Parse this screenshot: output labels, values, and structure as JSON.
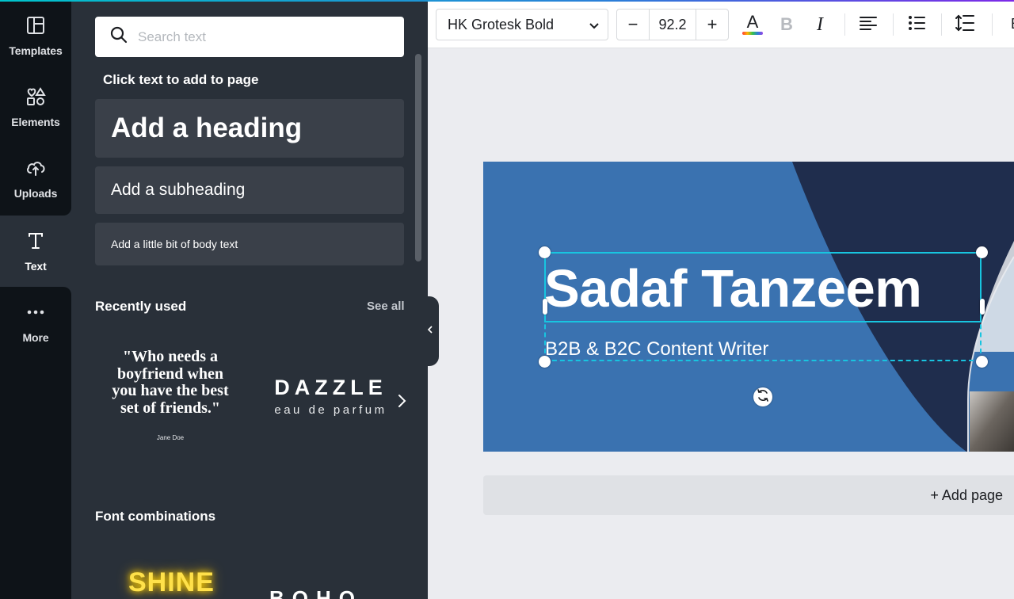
{
  "colors": {
    "rail_bg": "#0e1318",
    "panel_bg": "#293039",
    "button_bg": "#3a4049",
    "design_blue": "#3a72b0",
    "design_navy": "#1f2d4d",
    "selection": "#18c5e0",
    "canvas_bg": "#ebecf0"
  },
  "rail": {
    "items": [
      {
        "label": "Templates",
        "icon": "templates-icon"
      },
      {
        "label": "Elements",
        "icon": "elements-icon"
      },
      {
        "label": "Uploads",
        "icon": "uploads-icon"
      },
      {
        "label": "Text",
        "icon": "text-icon",
        "active": true
      },
      {
        "label": "More",
        "icon": "more-icon"
      }
    ]
  },
  "panel": {
    "search_placeholder": "Search text",
    "hint": "Click text to add to page",
    "heading_button": "Add a heading",
    "subheading_button": "Add a subheading",
    "body_button": "Add a little bit of body text",
    "recently_used_title": "Recently used",
    "see_all": "See all",
    "quote_template": {
      "text": "\"Who needs a boyfriend when you have the best set of friends.\"",
      "author": "Jane Doe"
    },
    "dazzle_template": {
      "title": "DAZZLE",
      "subtitle": "eau de parfum"
    },
    "font_combinations_title": "Font combinations",
    "combo_1": "SHINE",
    "combo_2": "BOHO"
  },
  "toolbar": {
    "font_name": "HK Grotesk Bold",
    "decrease": "−",
    "font_size": "92.2",
    "increase": "+",
    "text_color_glyph": "A",
    "bold_glyph": "B",
    "italic_glyph": "I",
    "overflow_glyph": "E"
  },
  "design": {
    "headline": "Sadaf Tanzeem",
    "subline": "B2B & B2C Content Writer"
  },
  "add_page": "+ Add page"
}
